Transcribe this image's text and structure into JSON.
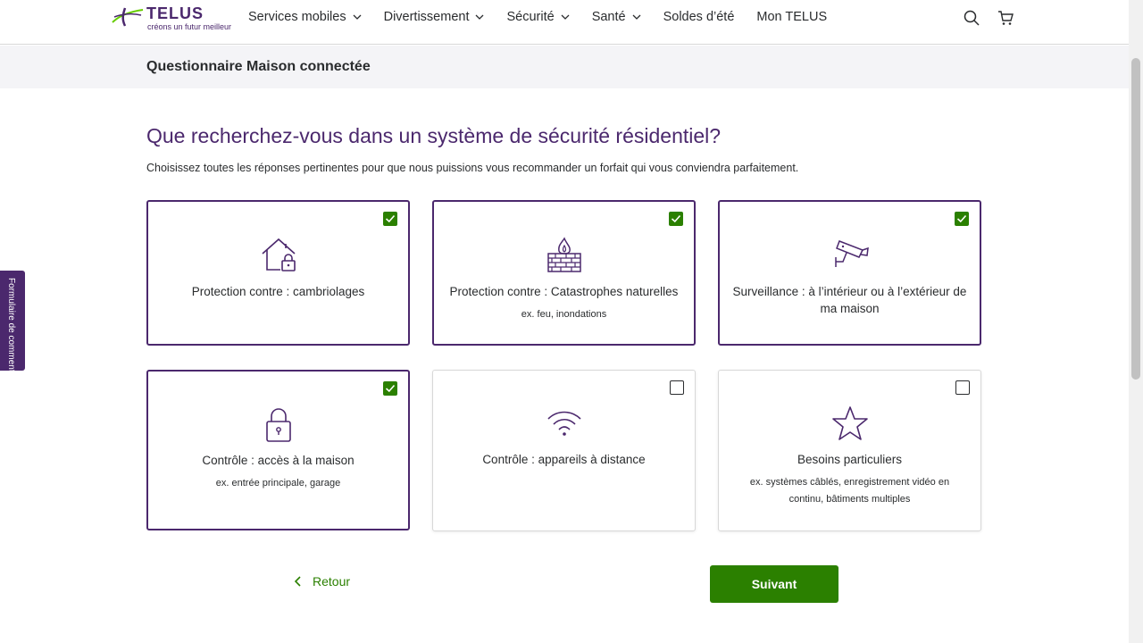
{
  "brand": {
    "name": "TELUS",
    "tagline": "créons un futur meilleur"
  },
  "nav": {
    "items": [
      {
        "label": "Services mobiles",
        "dropdown": true
      },
      {
        "label": "Divertissement",
        "dropdown": true
      },
      {
        "label": "Sécurité",
        "dropdown": true
      },
      {
        "label": "Santé",
        "dropdown": true
      },
      {
        "label": "Soldes d’été",
        "dropdown": false
      },
      {
        "label": "Mon TELUS",
        "dropdown": false
      }
    ],
    "icons": [
      "search-icon",
      "cart-icon"
    ]
  },
  "subheader": {
    "title": "Questionnaire Maison connectée"
  },
  "feedback": {
    "label": "Formulaire de comment"
  },
  "main": {
    "question": "Que recherchez-vous dans un système de sécurité résidentiel?",
    "instruction": "Choisissez toutes les réponses pertinentes pour que nous puissions vous recommander un forfait qui vous conviendra parfaitement.",
    "options": [
      {
        "title": "Protection contre : cambriolages",
        "subtitle": "",
        "checked": true,
        "icon": "house-lock-icon"
      },
      {
        "title": "Protection contre : Catastrophes naturelles",
        "subtitle": "ex. feu, inondations",
        "checked": true,
        "icon": "firewall-icon"
      },
      {
        "title": "Surveillance : à l’intérieur ou à l’extérieur de ma maison",
        "subtitle": "",
        "checked": true,
        "icon": "security-camera-icon"
      },
      {
        "title": "Contrôle : accès à la maison",
        "subtitle": "ex. entrée principale, garage",
        "checked": true,
        "icon": "padlock-icon"
      },
      {
        "title": "Contrôle : appareils à distance",
        "subtitle": "",
        "checked": false,
        "icon": "wifi-icon"
      },
      {
        "title": "Besoins particuliers",
        "subtitle": "ex. systèmes câblés, enregistrement vidéo en continu, bâtiments multiples",
        "checked": false,
        "icon": "star-icon"
      }
    ],
    "back_label": "Retour",
    "next_label": "Suivant"
  },
  "colors": {
    "brand_purple": "#4b286d",
    "accent_green": "#2b8000",
    "checkbox_green": "#2b8000"
  }
}
